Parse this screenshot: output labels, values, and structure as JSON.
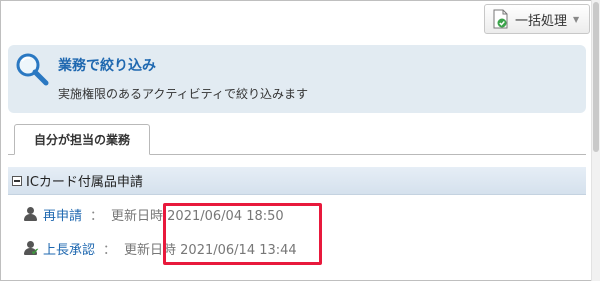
{
  "toolbar": {
    "bulk_label": "一括処理",
    "bulk_icon": "document-check-icon"
  },
  "filter": {
    "icon": "magnifier-icon",
    "title": "業務で絞り込み",
    "description": "実施権限のあるアクティビティで絞り込みます"
  },
  "tabs": [
    {
      "label": "自分が担当の業務",
      "active": true
    }
  ],
  "section": {
    "title": "ICカード付属品申請",
    "collapse_icon": "collapse-minus-icon"
  },
  "items": [
    {
      "icon": "user-icon",
      "label": "再申請",
      "separator": "：",
      "updated": "更新日時 2021/06/04 18:50"
    },
    {
      "icon": "user-approve-icon",
      "label": "上長承認",
      "separator": "：",
      "updated": "更新日時 2021/06/14 13:44"
    }
  ],
  "colors": {
    "link": "#1f68b0",
    "panel_bg": "#e2ebf2",
    "highlight": "#e8193c"
  }
}
